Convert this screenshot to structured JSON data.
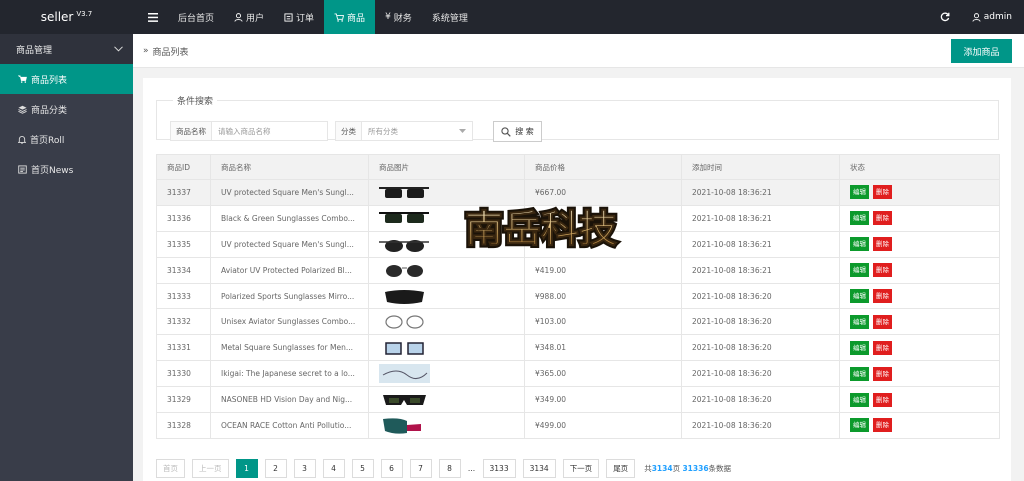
{
  "brand": {
    "name": "seller",
    "version": "V3.7"
  },
  "topnav": {
    "menu_icon": "hamburger-icon",
    "items": [
      {
        "label": "后台首页",
        "icon": ""
      },
      {
        "label": "用户",
        "icon": "user-icon"
      },
      {
        "label": "订单",
        "icon": "order-icon"
      },
      {
        "label": "商品",
        "icon": "cart-icon",
        "active": true
      },
      {
        "label": "财务",
        "icon": "yen-icon"
      },
      {
        "label": "系统管理",
        "icon": ""
      }
    ],
    "refresh_icon": "refresh-icon",
    "admin": "admin"
  },
  "sidebar": {
    "group": "商品管理",
    "items": [
      {
        "label": "商品列表",
        "icon": "cart-icon",
        "active": true
      },
      {
        "label": "商品分类",
        "icon": "layers-icon"
      },
      {
        "label": "首页Roll",
        "icon": "bell-icon"
      },
      {
        "label": "首页News",
        "icon": "news-icon"
      }
    ]
  },
  "breadcrumb": {
    "label": "商品列表"
  },
  "add_button": "添加商品",
  "search": {
    "legend": "条件搜索",
    "name_label": "商品名称",
    "name_placeholder": "请输入商品名称",
    "category_label": "分类",
    "category_value": "所有分类",
    "button": "搜 索"
  },
  "table": {
    "headers": [
      "商品ID",
      "商品名称",
      "商品图片",
      "商品价格",
      "添加时间",
      "状态"
    ],
    "edit_label": "编辑",
    "delete_label": "删除",
    "rows": [
      {
        "id": "31337",
        "name": "UV protected Square Men's Sungl...",
        "price": "¥667.00",
        "time": "2021-10-08 18:36:21"
      },
      {
        "id": "31336",
        "name": "Black & Green Sunglasses Combo...",
        "price": "",
        "time": "2021-10-08 18:36:21"
      },
      {
        "id": "31335",
        "name": "UV protected Square Men's Sungl...",
        "price": "",
        "time": "2021-10-08 18:36:21"
      },
      {
        "id": "31334",
        "name": "Aviator UV Protected Polarized Bl...",
        "price": "¥419.00",
        "time": "2021-10-08 18:36:21"
      },
      {
        "id": "31333",
        "name": "Polarized Sports Sunglasses Mirro...",
        "price": "¥988.00",
        "time": "2021-10-08 18:36:20"
      },
      {
        "id": "31332",
        "name": "Unisex Aviator Sunglasses Combo...",
        "price": "¥103.00",
        "time": "2021-10-08 18:36:20"
      },
      {
        "id": "31331",
        "name": "Metal Square Sunglasses for Men...",
        "price": "¥348.01",
        "time": "2021-10-08 18:36:20"
      },
      {
        "id": "31330",
        "name": "Ikigai: The Japanese secret to a lo...",
        "price": "¥365.00",
        "time": "2021-10-08 18:36:20"
      },
      {
        "id": "31329",
        "name": "NASONEB HD Vision Day and Nig...",
        "price": "¥349.00",
        "time": "2021-10-08 18:36:20"
      },
      {
        "id": "31328",
        "name": "OCEAN RACE Cotton Anti Pollutio...",
        "price": "¥499.00",
        "time": "2021-10-08 18:36:20"
      }
    ]
  },
  "pagination": {
    "first": "首页",
    "prev": "上一页",
    "pages": [
      "1",
      "2",
      "3",
      "4",
      "5",
      "6",
      "7",
      "8"
    ],
    "current": "1",
    "ellipsis": "...",
    "tail_pages": [
      "3133",
      "3134"
    ],
    "next": "下一页",
    "last": "尾页",
    "total_prefix": "共",
    "total_pages": "3134",
    "total_mid": "页",
    "total_items": "31336",
    "total_suffix": "条数据"
  },
  "watermark": {
    "text": "南岳科技"
  },
  "colors": {
    "accent": "#009688",
    "topbar": "#23262e",
    "sidebar": "#393d49",
    "edit": "#0c9a2c",
    "delete": "#e01e1e",
    "highlight": "#1e9fff"
  }
}
